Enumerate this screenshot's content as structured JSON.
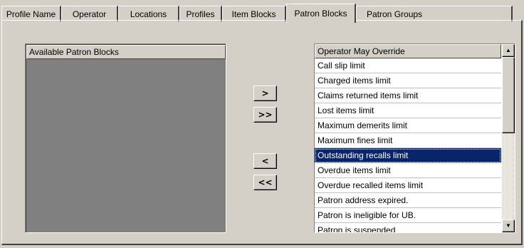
{
  "tabs": [
    {
      "label": "Profile Name",
      "active": false
    },
    {
      "label": "Operator",
      "active": false
    },
    {
      "label": "Locations",
      "active": false
    },
    {
      "label": "Profiles",
      "active": false
    },
    {
      "label": "Item Blocks",
      "active": false
    },
    {
      "label": "Patron Blocks",
      "active": true
    },
    {
      "label": "Patron Groups",
      "active": false
    }
  ],
  "available_list": {
    "header": "Available Patron Blocks",
    "items": []
  },
  "buttons": {
    "add_one": ">",
    "add_all": ">>",
    "remove_one": "<",
    "remove_all": "<<"
  },
  "override_list": {
    "header": "Operator May Override",
    "items": [
      "Call slip limit",
      "Charged items limit",
      "Claims returned items limit",
      "Lost items limit",
      "Maximum demerits limit",
      "Maximum fines limit",
      "Outstanding recalls limit",
      "Overdue items limit",
      "Overdue recalled items limit",
      "Patron address expired.",
      "Patron is ineligible for UB.",
      "Patron is suspended"
    ],
    "selected_index": 6
  },
  "colors": {
    "face": "#d4d0c8",
    "selection": "#0a246a",
    "list_empty": "#808080"
  }
}
